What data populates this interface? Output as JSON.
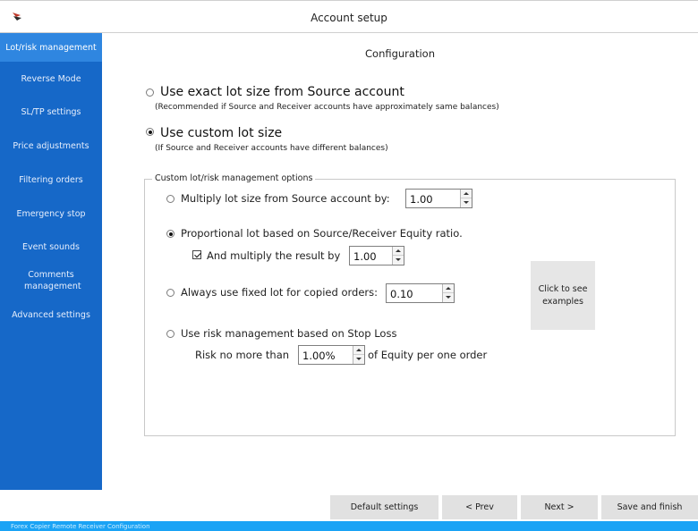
{
  "window": {
    "title": "Account setup",
    "icon": "app-flag-icon"
  },
  "sidebar": {
    "items": [
      {
        "label": "Lot/risk management",
        "active": true
      },
      {
        "label": "Reverse Mode"
      },
      {
        "label": "SL/TP settings"
      },
      {
        "label": "Price adjustments"
      },
      {
        "label": "Filtering orders"
      },
      {
        "label": "Emergency stop"
      },
      {
        "label": "Event sounds"
      },
      {
        "label": "Comments management"
      },
      {
        "label": "Advanced settings"
      }
    ]
  },
  "main": {
    "title": "Configuration",
    "lot_mode": {
      "exact": {
        "label": "Use exact lot size from Source account",
        "note": "(Recommended if Source and Receiver accounts have approximately same balances)",
        "selected": false
      },
      "custom": {
        "label": "Use custom lot size",
        "note": "(If Source and Receiver accounts have different balances)",
        "selected": true
      }
    },
    "custom_options": {
      "legend": "Custom lot/risk management options",
      "multiply": {
        "label": "Multiply lot size from Source account by:",
        "value": "1.00",
        "selected": false
      },
      "proportional": {
        "label": "Proportional lot based on Source/Receiver Equity ratio.",
        "selected": true,
        "and_multiply": {
          "label": "And multiply the result by",
          "value": "1.00",
          "checked": true
        }
      },
      "fixed": {
        "label": "Always use fixed lot for copied orders:",
        "value": "0.10",
        "selected": false
      },
      "risk": {
        "label": "Use risk management based on Stop Loss",
        "selected": false,
        "prefix": "Risk no more than",
        "value": "1.00%",
        "suffix": "of Equity per one order"
      }
    },
    "examples_button": "Click to see examples"
  },
  "footer": {
    "default_settings": "Default settings",
    "prev": "< Prev",
    "next": "Next >",
    "save_finish": "Save and finish"
  },
  "statusbar": {
    "text": "Forex Copier Remote Receiver Configuration"
  },
  "colors": {
    "sidebar": "#1668c8",
    "sidebar_active": "#2f86e0",
    "statusbar": "#1aa3f5",
    "button": "#e1e1e1"
  }
}
